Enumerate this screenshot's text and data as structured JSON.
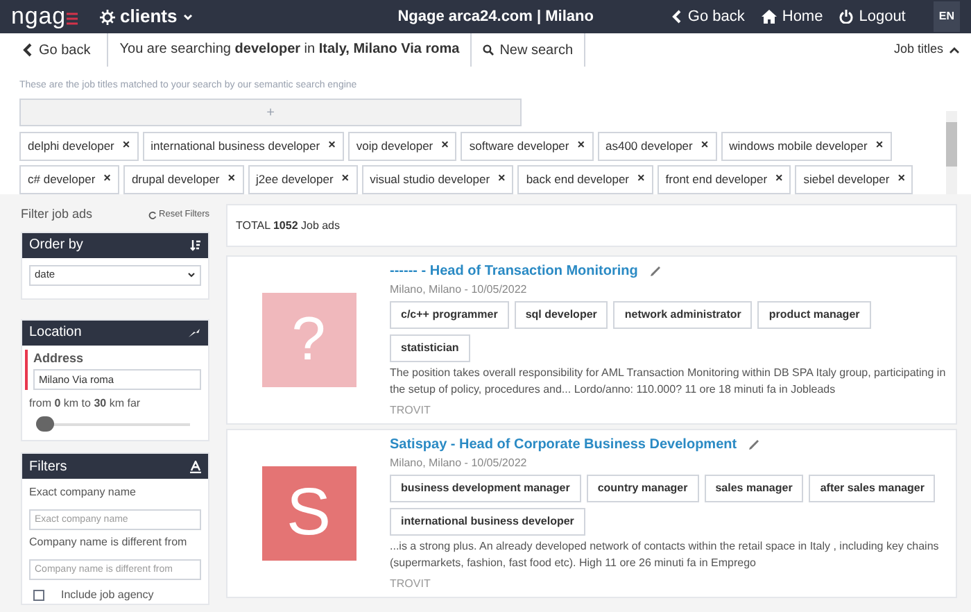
{
  "header": {
    "logo": "ngag",
    "menu": "clients",
    "title": "Ngage arca24.com | Milano",
    "links": [
      {
        "kind": "back",
        "label": "Go back"
      },
      {
        "kind": "home",
        "label": "Home"
      },
      {
        "kind": "logout",
        "label": "Logout"
      }
    ],
    "language": "EN"
  },
  "search_bar": {
    "back": "Go back",
    "summary": "You are searching **developer** in **Italy, Milano Via roma**",
    "new_search": "New search",
    "toggle": "Job titles",
    "expanded": true
  },
  "job_titles": {
    "hint": "These are the job titles matched to your search by our semantic search engine",
    "add": "+",
    "remove": "×",
    "tags": [
      "delphi developer",
      "international business developer",
      "voip developer",
      "software developer",
      "as400 developer",
      "windows mobile developer",
      "c# developer",
      "drupal developer",
      "j2ee developer",
      "visual studio developer",
      "back end developer",
      "front end developer",
      "siebel developer"
    ]
  },
  "sidebar": {
    "title": "Filter job ads",
    "reset": "Reset Filters",
    "order": {
      "title": "Order by",
      "value": "date"
    },
    "location": {
      "title": "Location",
      "address_label": "Address",
      "address": "Milano Via roma",
      "range": "from **0** km to **30** km far",
      "level": 0
    },
    "filters": {
      "title": "Filters",
      "fields": [
        {
          "label": "Exact company name",
          "placeholder": "Exact company name"
        },
        {
          "label": "Company name is different from",
          "placeholder": "Company name is different from"
        }
      ],
      "agency": {
        "label": "Include job agency",
        "checked": false
      }
    }
  },
  "results": {
    "total": "TOTAL **1052** Job ads",
    "jobs": [
      {
        "logo": "?",
        "color": "#f0b8bc",
        "title": "------ - Head of Transaction Monitoring",
        "place": "Milano, Milano - 10/05/2022",
        "tags": [
          "c/c++ programmer",
          "sql developer",
          "network administrator",
          "product manager",
          "statistician"
        ],
        "description": "The position takes overall responsibility for AML Transaction Monitoring within DB SPA Italy group, participating in the setup of policy, procedures and... Lordo/anno: 110.000? 11 ore 18 minuti fa in Jobleads",
        "source": "TROVIT"
      },
      {
        "logo": "S",
        "color": "#e47474",
        "title": "Satispay - Head of Corporate Business Development",
        "place": "Milano, Milano - 10/05/2022",
        "tags": [
          "business development manager",
          "country manager",
          "sales manager",
          "after sales manager",
          "international business developer"
        ],
        "description": "...is a strong plus. An already developed network of contacts within the retail space in Italy , including key chains (supermarkets, fashion, fast food etc). High 11 ore 26 minuti fa in Emprego",
        "source": "TROVIT"
      }
    ]
  }
}
